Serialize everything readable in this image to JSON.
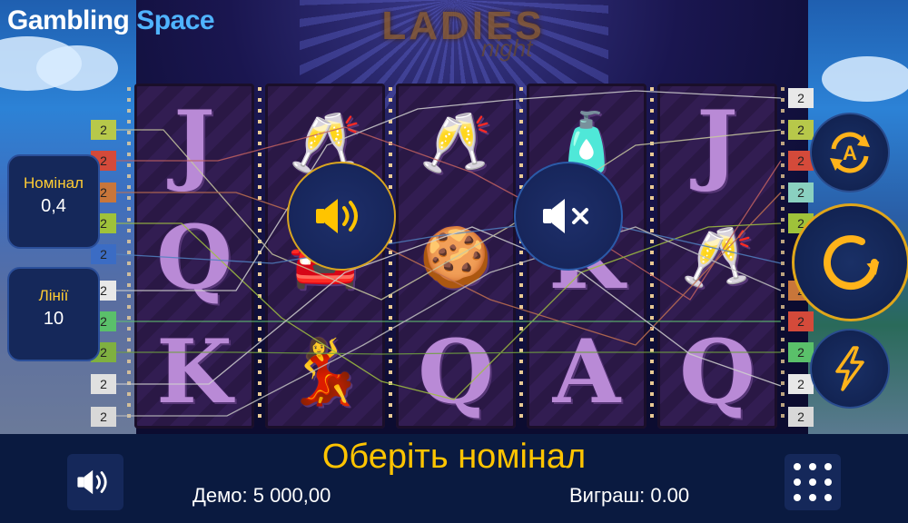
{
  "logo": {
    "part1": "Gambling",
    "part2": "Space"
  },
  "marquee": {
    "title": "LADIES",
    "subtitle": "night"
  },
  "reels": [
    [
      "J",
      "Q",
      "K"
    ],
    [
      "champagne",
      "limo",
      "lady"
    ],
    [
      "champagne",
      "macarons",
      "Q"
    ],
    [
      "perfume",
      "K",
      "A"
    ],
    [
      "J",
      "champagne",
      "Q"
    ]
  ],
  "lines": {
    "left_markers": [
      "2",
      "2",
      "2",
      "2",
      "2",
      "2",
      "2",
      "2",
      "2",
      "2"
    ],
    "right_markers": [
      "2",
      "2",
      "2",
      "2",
      "2",
      "2",
      "2",
      "2",
      "2",
      "2"
    ]
  },
  "panels": {
    "bet": {
      "label": "Номінал",
      "value": "0,4"
    },
    "lines": {
      "label": "Лінії",
      "value": "10"
    }
  },
  "status": {
    "message": "Оберіть номінал",
    "balance": "Демо: 5 000,00",
    "win": "Виграш: 0.00"
  },
  "icons": {
    "sound_on": "speaker-on-icon",
    "sound_off": "speaker-muted-icon",
    "autoplay": "autoplay-icon",
    "spin": "spin-icon",
    "turbo": "lightning-icon",
    "menu": "menu-grid-icon"
  },
  "colors": {
    "accent": "#ffc400",
    "panel": "#15285a",
    "spin_ring": "#e0a61a"
  }
}
